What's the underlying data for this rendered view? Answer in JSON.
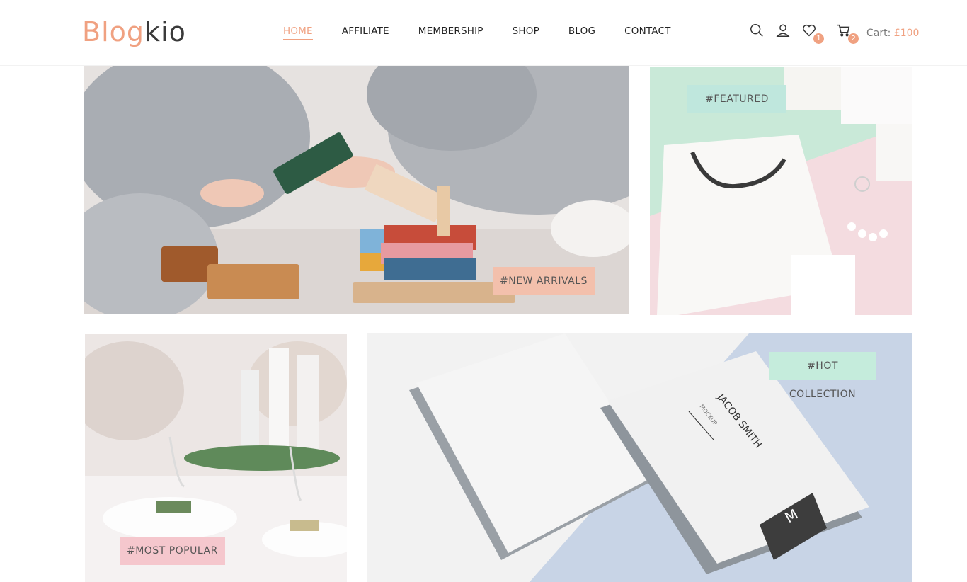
{
  "brand": {
    "part1": "Blog",
    "part2": "kio"
  },
  "nav": {
    "items": [
      {
        "label": "HOME",
        "active": true
      },
      {
        "label": "AFFILIATE",
        "active": false
      },
      {
        "label": "MEMBERSHIP",
        "active": false
      },
      {
        "label": "SHOP",
        "active": false
      },
      {
        "label": "BLOG",
        "active": false
      },
      {
        "label": "CONTACT",
        "active": false
      }
    ]
  },
  "header_icons": {
    "search": "search-icon",
    "user": "user-icon",
    "wishlist": {
      "icon": "heart-icon",
      "count": "1"
    },
    "cart": {
      "icon": "cart-icon",
      "count": "2"
    },
    "cart_label": "Cart:",
    "cart_amount": "£100"
  },
  "tiles": {
    "new_arrivals": {
      "tag": "#NEW ARRIVALS",
      "tag_color": "#f3c0ac"
    },
    "featured": {
      "tag": "#FEATURED",
      "tag_color": "#bfe7dd"
    },
    "most_popular": {
      "tag": "#MOST POPULAR",
      "tag_color": "#f5c7cd"
    },
    "hot_collection": {
      "tag": "#HOT COLLECTION",
      "tag_color": "#c5ecdc"
    }
  },
  "card_mockup": {
    "name": "JACOB SMITH",
    "subtitle": "MOCKUP",
    "monogram": "M"
  },
  "colors": {
    "accent": "#f0a181",
    "text": "#222222"
  }
}
